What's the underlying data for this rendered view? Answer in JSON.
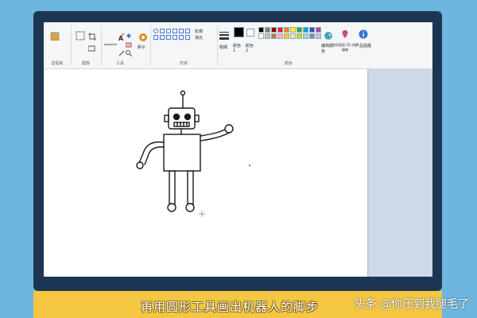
{
  "ribbon": {
    "groups": [
      {
        "label": "剪贴板"
      },
      {
        "label": "图像"
      },
      {
        "label": "工具"
      },
      {
        "label": "形状"
      },
      {
        "label": "颜色"
      }
    ],
    "brush_label": "刷子",
    "shapes_label": "形状",
    "size_label": "粗细",
    "color1_label": "颜色 1",
    "color2_label": "颜色 2",
    "edit_colors_label": "编辑颜色",
    "paint3d_label": "使用画图 3D 进行编辑",
    "product_alert_label": "产品提醒",
    "outline_label": "轮廓",
    "fill_label": "填充",
    "palette": [
      "#000000",
      "#7f7f7f",
      "#880015",
      "#ed1c24",
      "#ff7f27",
      "#fff200",
      "#22b14c",
      "#00a2e8",
      "#3f48cc",
      "#a349a4",
      "#ffffff",
      "#c3c3c3",
      "#b97a57",
      "#ffaec9",
      "#ffc90e",
      "#efe4b0",
      "#b5e61d",
      "#99d9ea",
      "#7092be",
      "#c8bfe7"
    ]
  },
  "caption": "再用圆形工具画出机器人的脚步",
  "credit": "头条 @你压到我腿毛了"
}
